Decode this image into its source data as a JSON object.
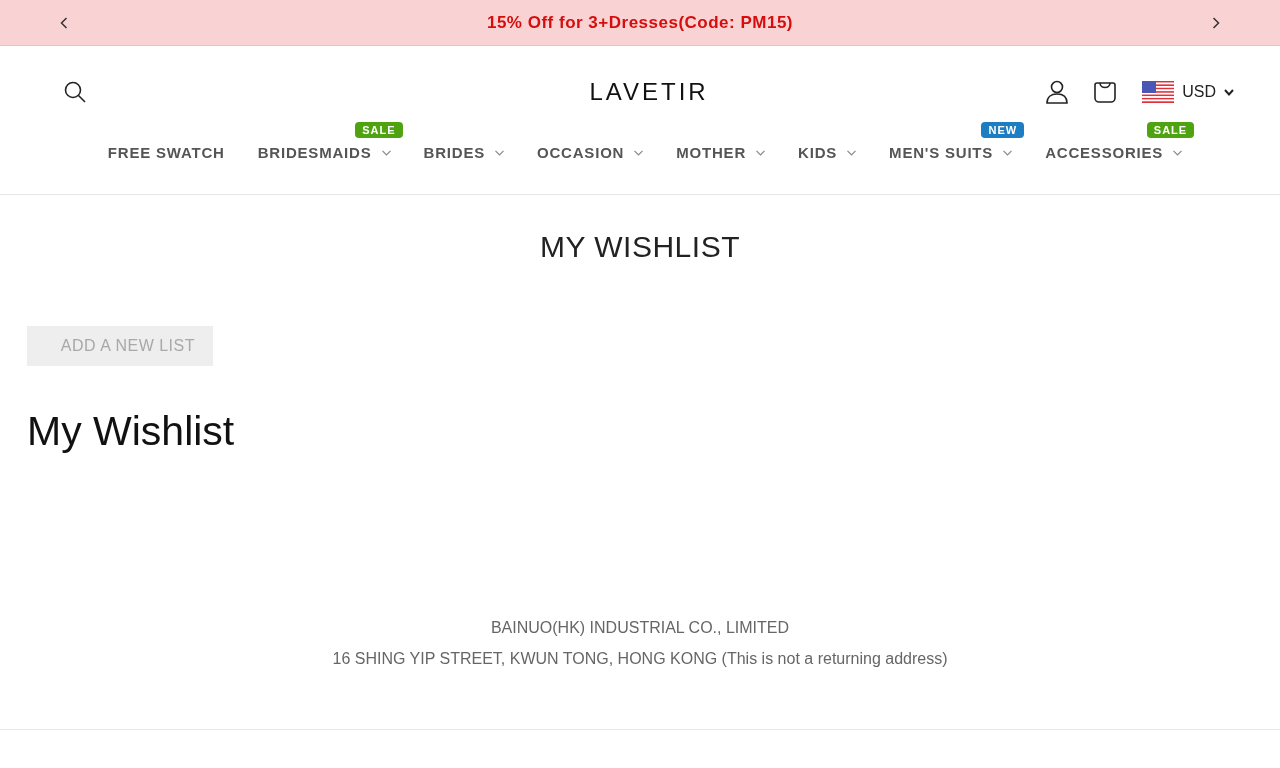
{
  "announcement": {
    "text": "15% Off for 3+Dresses(Code: PM15)"
  },
  "header": {
    "logo": "LAVETIR",
    "currency": "USD"
  },
  "nav": [
    {
      "label": "FREE SWATCH",
      "has_menu": false
    },
    {
      "label": "BRIDESMAIDS",
      "has_menu": true,
      "badge": {
        "text": "SALE",
        "color": "#4fa311"
      }
    },
    {
      "label": "BRIDES",
      "has_menu": true
    },
    {
      "label": "OCCASION",
      "has_menu": true
    },
    {
      "label": "MOTHER",
      "has_menu": true
    },
    {
      "label": "KIDS",
      "has_menu": true
    },
    {
      "label": "MEN'S SUITS",
      "has_menu": true,
      "badge": {
        "text": "NEW",
        "color": "#1d7dc2"
      }
    },
    {
      "label": "ACCESSORIES",
      "has_menu": true,
      "badge": {
        "text": "SALE",
        "color": "#4fa311"
      }
    }
  ],
  "page": {
    "title": "MY WISHLIST",
    "add_button": {
      "label": "ADD A NEW LIST",
      "disabled": true
    },
    "list_title": "My Wishlist"
  },
  "footer": {
    "lines": [
      "BAINUO(HK) INDUSTRIAL CO., LIMITED",
      "16 SHING YIP STREET, KWUN TONG, HONG KONG (This is not a returning address)"
    ]
  }
}
